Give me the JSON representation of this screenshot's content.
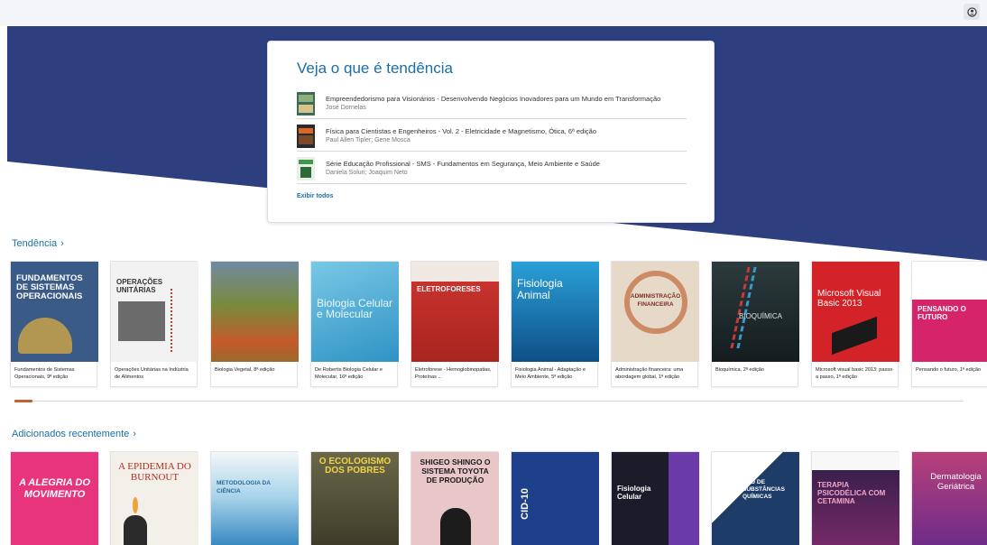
{
  "header": {
    "account_icon": "account-circle-icon"
  },
  "colors": {
    "hero_blue": "#2e3f80",
    "accent": "#1a6fa4",
    "scroll_thumb": "#c4622d"
  },
  "trending_card": {
    "title": "Veja o que é tendência",
    "items": [
      {
        "title": "Empreendedorismo para Visionários - Desenvolvendo Negócios Inovadores para um Mundo em Transformação",
        "author": "José Dornelas"
      },
      {
        "title": "Física para Cientistas e Engenheiros - Vol. 2 - Eletricidade e Magnetismo, Ótica, 6ª edição",
        "author": "Paul Allen Tipler; Gene Mosca"
      },
      {
        "title": "Série Educação Profissional - SMS - Fundamentos em Segurança, Meio Ambiente e Saúde",
        "author": "Daniela Soluri; Joaquim Neto"
      }
    ],
    "view_all": "Exibir todos"
  },
  "sections": {
    "trending": {
      "title": "Tendência",
      "books": [
        {
          "label": "Fundamentos de Sistemas Operacionais, 9ª edição",
          "cover_title": "FUNDAMENTOS DE SISTEMAS OPERACIONAIS",
          "bg": "#3a5a88",
          "fg": "#ffffff"
        },
        {
          "label": "Operações Unitárias na Indústria de Alimentos",
          "cover_title": "OPERAÇÕES UNITÁRIAS",
          "bg": "#f2f2f2",
          "fg": "#333333"
        },
        {
          "label": "Biologia Vegetal, 8ª edição",
          "cover_title": "",
          "bg": "#7a8a3a",
          "fg": "#ffffff"
        },
        {
          "label": "De Robertis Biologia Celular e Molecular, 16ª edição",
          "cover_title": "Biologia Celular e Molecular",
          "bg": "#4fb3d9",
          "fg": "#e8f6fb"
        },
        {
          "label": "Eletroforese - Hemoglobinopatias, Proteínas ...",
          "cover_title": "ELETROFORESES",
          "bg": "#c8322d",
          "fg": "#ffffff"
        },
        {
          "label": "Fisiologia Animal - Adaptação e Meio Ambiente, 5ª edição",
          "cover_title": "Fisiologia Animal",
          "bg": "#1f86c6",
          "fg": "#ffffff"
        },
        {
          "label": "Administração financeira: uma abordagem global, 1ª edição",
          "cover_title": "ADMINISTRAÇÃO FINANCEIRA",
          "bg": "#e7d9c7",
          "fg": "#7a2e22"
        },
        {
          "label": "Bioquímica, 2ª edição",
          "cover_title": "BIOQUÍMICA",
          "bg": "#1c2a2e",
          "fg": "#d8e6e8"
        },
        {
          "label": "Microsoft visual basic 2013: passo a passo, 1ª edição",
          "cover_title": "Microsoft Visual Basic 2013",
          "bg": "#d42328",
          "fg": "#ffffff"
        },
        {
          "label": "Pensando o futuro, 1ª edição",
          "cover_title": "PENSANDO O FUTURO",
          "bg": "#d6246b",
          "fg": "#ffffff"
        }
      ]
    },
    "recent": {
      "title": "Adicionados recentemente",
      "books": [
        {
          "cover_title": "A ALEGRIA DO MOVIMENTO",
          "bg": "#e8347c",
          "fg": "#ffffff"
        },
        {
          "cover_title": "A EPIDEMIA DO BURNOUT",
          "bg": "#f3f0ea",
          "fg": "#b42c20"
        },
        {
          "cover_title": "METODOLOGIA DA CIÊNCIA",
          "bg": "#3a9bd0",
          "fg": "#ffffff"
        },
        {
          "cover_title": "O ECOLOGISMO DOS POBRES",
          "bg": "#5b5a3a",
          "fg": "#f0d34a"
        },
        {
          "cover_title": "SHIGEO SHINGO O SISTEMA TOYOTA DE PRODUÇÃO",
          "bg": "#e9c7c9",
          "fg": "#1a1a1a"
        },
        {
          "cover_title": "CID-10",
          "bg": "#1d3f8c",
          "fg": "#ffffff"
        },
        {
          "cover_title": "Fisiologia Celular",
          "bg": "#1b1b2a",
          "fg": "#ffffff"
        },
        {
          "cover_title": "USO DE SUBSTÂNCIAS QUÍMICAS",
          "bg": "#1e3c68",
          "fg": "#ffffff"
        },
        {
          "cover_title": "TERAPIA PSICODÉLICA COM CETAMINA",
          "bg": "#3a1f4c",
          "fg": "#f2a7c9"
        },
        {
          "cover_title": "Dermatologia Geriátrica",
          "bg": "#b8407a",
          "fg": "#ffffff"
        }
      ]
    }
  }
}
